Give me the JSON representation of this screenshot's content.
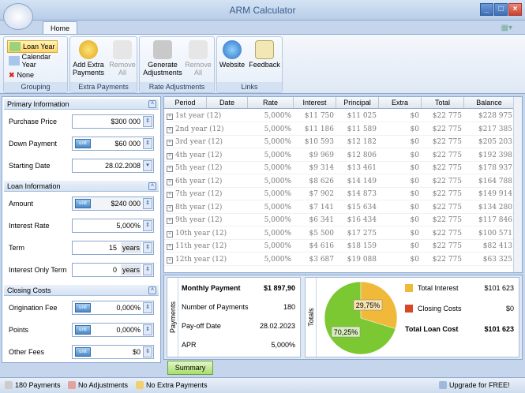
{
  "window": {
    "title": "ARM Calculator"
  },
  "ribbon": {
    "tab": "Home",
    "grouping": {
      "label": "Grouping",
      "items": [
        "Loan Year",
        "Calendar Year",
        "None"
      ]
    },
    "extra_payments": {
      "label": "Extra Payments",
      "add": "Add Extra Payments",
      "remove": "Remove All"
    },
    "rate_adjustments": {
      "label": "Rate Adjustments",
      "generate": "Generate Adjustments",
      "remove": "Remove All"
    },
    "links": {
      "label": "Links",
      "website": "Website",
      "feedback": "Feedback"
    }
  },
  "primary": {
    "header": "Primary Information",
    "purchase_price_label": "Purchase Price",
    "purchase_price": "$300 000",
    "down_payment_label": "Down Payment",
    "down_payment": "$60 000",
    "starting_date_label": "Starting Date",
    "starting_date": "28.02.2008"
  },
  "loan": {
    "header": "Loan Information",
    "amount_label": "Amount",
    "amount": "$240 000",
    "rate_label": "Interest Rate",
    "rate": "5,000%",
    "term_label": "Term",
    "term": "15",
    "term_unit": "years",
    "io_label": "Interest Only Term",
    "io": "0",
    "io_unit": "years"
  },
  "closing": {
    "header": "Closing Costs",
    "orig_label": "Origination Fee",
    "orig": "0,000%",
    "points_label": "Points",
    "points": "0,000%",
    "other_label": "Other Fees",
    "other": "$0"
  },
  "unit_tag": "unit",
  "grid": {
    "columns": [
      "Period",
      "Date",
      "Rate",
      "Interest",
      "Principal",
      "Extra",
      "Total",
      "Balance"
    ],
    "rows": [
      [
        "1st year (12)",
        "",
        "5,000%",
        "$11 750",
        "$11 025",
        "$0",
        "$22 775",
        "$228 975"
      ],
      [
        "2nd year (12)",
        "",
        "5,000%",
        "$11 186",
        "$11 589",
        "$0",
        "$22 775",
        "$217 385"
      ],
      [
        "3rd year (12)",
        "",
        "5,000%",
        "$10 593",
        "$12 182",
        "$0",
        "$22 775",
        "$205 203"
      ],
      [
        "4th year (12)",
        "",
        "5,000%",
        "$9 969",
        "$12 806",
        "$0",
        "$22 775",
        "$192 398"
      ],
      [
        "5th year (12)",
        "",
        "5,000%",
        "$9 314",
        "$13 461",
        "$0",
        "$22 775",
        "$178 937"
      ],
      [
        "6th year (12)",
        "",
        "5,000%",
        "$8 626",
        "$14 149",
        "$0",
        "$22 775",
        "$164 788"
      ],
      [
        "7th year (12)",
        "",
        "5,000%",
        "$7 902",
        "$14 873",
        "$0",
        "$22 775",
        "$149 914"
      ],
      [
        "8th year (12)",
        "",
        "5,000%",
        "$7 141",
        "$15 634",
        "$0",
        "$22 775",
        "$134 280"
      ],
      [
        "9th year (12)",
        "",
        "5,000%",
        "$6 341",
        "$16 434",
        "$0",
        "$22 775",
        "$117 846"
      ],
      [
        "10th year (12)",
        "",
        "5,000%",
        "$5 500",
        "$17 275",
        "$0",
        "$22 775",
        "$100 571"
      ],
      [
        "11th year (12)",
        "",
        "5,000%",
        "$4 616",
        "$18 159",
        "$0",
        "$22 775",
        "$82 413"
      ],
      [
        "12th year (12)",
        "",
        "5,000%",
        "$3 687",
        "$19 088",
        "$0",
        "$22 775",
        "$63 325"
      ]
    ]
  },
  "payments": {
    "label": "Payments",
    "monthly_label": "Monthly Payment",
    "monthly": "$1 897,90",
    "number_label": "Number of Payments",
    "number": "180",
    "payoff_label": "Pay-off Date",
    "payoff": "28.02.2023",
    "apr_label": "APR",
    "apr": "5,000%"
  },
  "totals": {
    "label": "Totals",
    "interest_label": "Total Interest",
    "interest": "$101 623",
    "closing_label": "Closing Costs",
    "closing": "$0",
    "loan_cost_label": "Total Loan Cost",
    "loan_cost": "$101 623",
    "pie_principal_pct": "70,25%",
    "pie_interest_pct": "29,75%",
    "principal_share": 70.25,
    "interest_share": 29.75
  },
  "summary_tab": "Summary",
  "status": {
    "payments": "180 Payments",
    "adjustments": "No Adjustments",
    "extra": "No Extra Payments",
    "upgrade": "Upgrade for FREE!"
  },
  "colors": {
    "pie_principal": "#7cc832",
    "pie_interest": "#f0b93a",
    "closing": "#d9472b"
  }
}
